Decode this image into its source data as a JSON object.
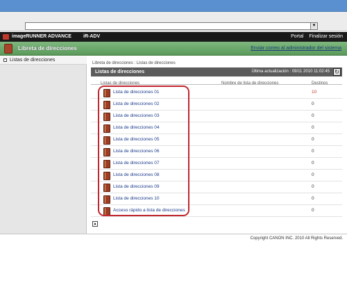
{
  "browser": {
    "address_value": ""
  },
  "header": {
    "brand": "imageRUNNER ADVANCE",
    "device": "iR-ADV",
    "portal": "Portal",
    "logout": "Finalizar sesión"
  },
  "page": {
    "title": "Libreta de direcciones",
    "admin_link": "Enviar correo al administrador del sistema"
  },
  "sidebar": {
    "items": [
      {
        "label": "Listas de direcciones"
      }
    ]
  },
  "breadcrumb": "Libreta de direcciones : Listas de direcciones",
  "panel": {
    "title": "Listas de direcciones",
    "last_update": "Última actualización : 09/11 2010 11:02:45"
  },
  "table": {
    "headers": [
      "Listas de direcciones",
      "Nombre de lista de direcciones",
      "Destinos"
    ],
    "rows": [
      {
        "name": "Lista de direcciones 01",
        "count": "10"
      },
      {
        "name": "Lista de direcciones 02",
        "count": "0"
      },
      {
        "name": "Lista de direcciones 03",
        "count": "0"
      },
      {
        "name": "Lista de direcciones 04",
        "count": "0"
      },
      {
        "name": "Lista de direcciones 05",
        "count": "0"
      },
      {
        "name": "Lista de direcciones 06",
        "count": "0"
      },
      {
        "name": "Lista de direcciones 07",
        "count": "0"
      },
      {
        "name": "Lista de direcciones 08",
        "count": "0"
      },
      {
        "name": "Lista de direcciones 09",
        "count": "0"
      },
      {
        "name": "Lista de direcciones 10",
        "count": "0"
      },
      {
        "name": "Acceso rápido a lista de direcciones",
        "count": "0"
      }
    ]
  },
  "footer": {
    "copyright": "Copyright CANON INC. 2010 All Rights Reserved."
  },
  "colors": {
    "header_green": "#6aa86a",
    "highlight": "#c0272d",
    "link": "#1a3a8a"
  }
}
